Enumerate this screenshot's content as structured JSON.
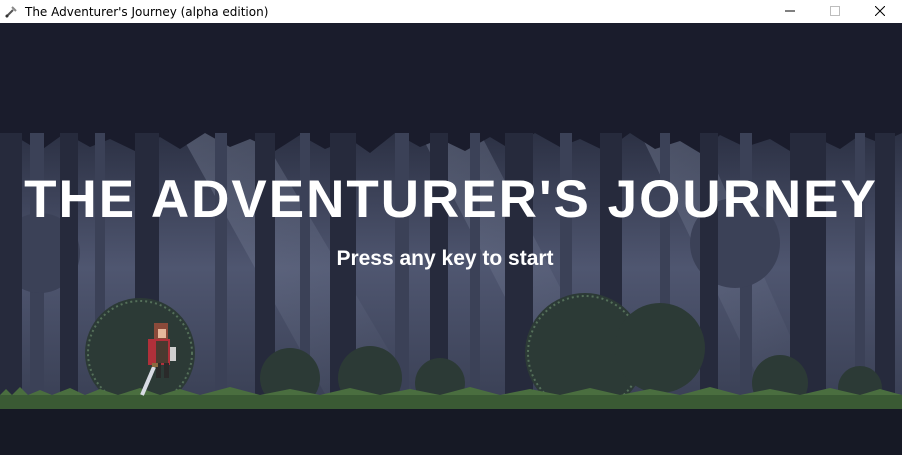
{
  "window": {
    "title": "The Adventurer's Journey (alpha edition)",
    "icon": "game-app-icon",
    "controls": {
      "minimize_icon": "minimize-icon",
      "maximize_icon": "maximize-icon",
      "close_icon": "close-icon"
    }
  },
  "game": {
    "title": "THE ADVENTURER'S JOURNEY",
    "prompt": "Press any key to start",
    "scene": "pixel-art-forest-night",
    "character": "adventurer-with-sword",
    "colors": {
      "sky": "#1a1c2c",
      "mist": "#5d6478",
      "tree_dark": "#1f2233",
      "tree_mid": "#353b4f",
      "bush": "#2a3d2e",
      "grass": "#3a5a34",
      "ground": "#161925",
      "text": "#ffffff"
    }
  }
}
